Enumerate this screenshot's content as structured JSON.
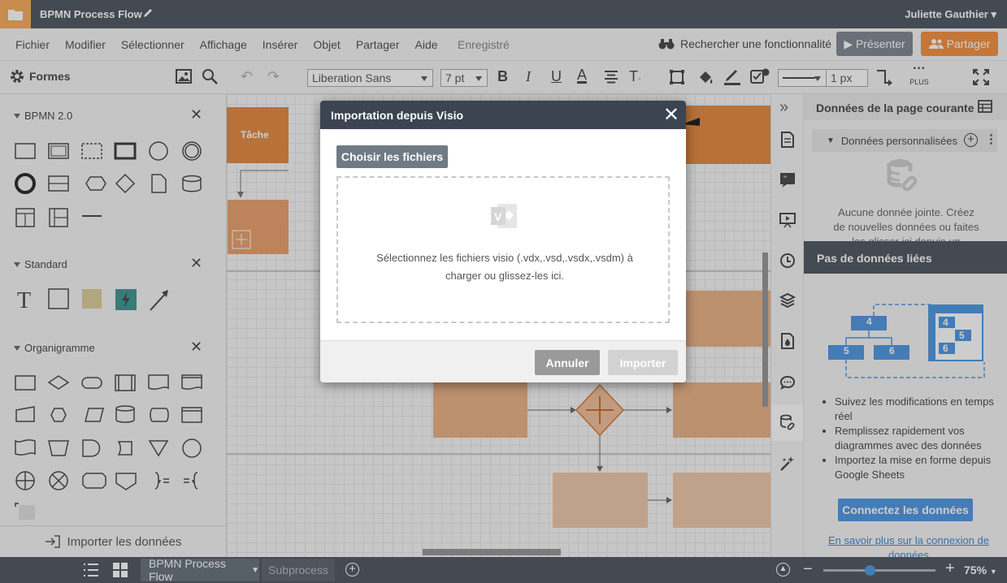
{
  "title_bar": {
    "document_title": "BPMN Process Flow",
    "user_name": "Juliette Gauthier"
  },
  "menu": {
    "items": [
      "Fichier",
      "Modifier",
      "Sélectionner",
      "Affichage",
      "Insérer",
      "Objet",
      "Partager",
      "Aide"
    ],
    "saved_status": "Enregistré",
    "feature_search": "Rechercher une fonctionnalité",
    "present_label": "Présenter",
    "share_label": "Partager"
  },
  "toolbar": {
    "font_name": "Liberation Sans",
    "font_size": "7 pt",
    "line_width": "1 px",
    "more_label": "PLUS"
  },
  "shapes_panel": {
    "title": "Formes",
    "sections": [
      "BPMN 2.0",
      "Standard",
      "Organigramme"
    ],
    "import_data_label": "Importer les données"
  },
  "canvas": {
    "task_label": "Tâche"
  },
  "data_panel": {
    "title": "Données de la page courante",
    "custom_data_label": "Données personnalisées",
    "no_data_text": "Aucune donnée jointe. Créez de nouvelles données ou faites les glisser ici depuis un",
    "no_linked_title": "Pas de données liées",
    "diagram_numbers": [
      "4",
      "5",
      "6",
      "4",
      "5",
      "6"
    ],
    "bullets": [
      "Suivez les modifications en temps réel",
      "Remplissez rapidement vos diagrammes avec des données",
      "Importez la mise en forme depuis Google Sheets"
    ],
    "connect_button": "Connectez les données",
    "learn_more": "En savoir plus sur la connexion de données"
  },
  "bottom_bar": {
    "page_tab_active": "BPMN Process Flow",
    "page_tab_other": "Subprocess",
    "zoom": "75%"
  },
  "modal": {
    "title": "Importation depuis Visio",
    "choose_files_label": "Choisir les fichiers",
    "dropzone_text": "Sélectionnez les fichiers visio (.vdx,.vsd,.vsdx,.vsdm) à charger ou glissez-les ici.",
    "cancel_label": "Annuler",
    "import_label": "Importer"
  },
  "colors": {
    "dark": "#3b4450",
    "orange": "#f3852a",
    "blue": "#3b8ce0",
    "shape_orange": "#e07b2c"
  }
}
